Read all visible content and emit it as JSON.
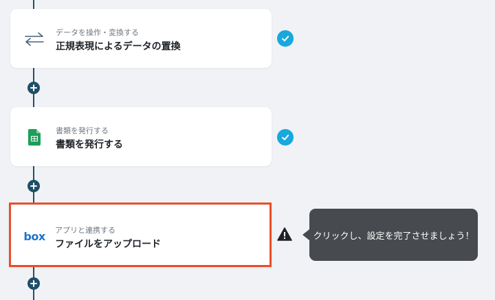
{
  "steps": [
    {
      "subtitle": "データを操作・変換する",
      "title": "正規表現によるデータの置換",
      "icon": "swap-arrows-icon",
      "status": "completed"
    },
    {
      "subtitle": "書類を発行する",
      "title": "書類を発行する",
      "icon": "google-sheets-icon",
      "status": "completed"
    },
    {
      "subtitle": "アプリと連携する",
      "title": "ファイルをアップロード",
      "icon": "box-logo",
      "logo_text": "box",
      "status": "incomplete"
    }
  ],
  "tooltip": {
    "text": "クリックし、設定を完了させましょう！"
  },
  "colors": {
    "accent": "#18a8dc",
    "selected_border": "#ea4d27",
    "flow_line": "#1f4f68",
    "tooltip_bg": "#474a4f"
  }
}
